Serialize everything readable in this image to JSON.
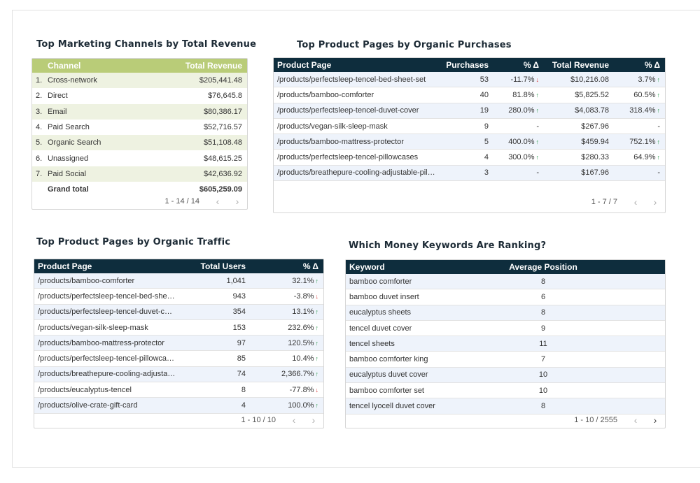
{
  "channels": {
    "title": "Top Marketing Channels by Total Revenue",
    "headers": [
      "Channel",
      "Total Revenue"
    ],
    "rows": [
      {
        "idx": "1.",
        "name": "Cross-network",
        "value": "$205,441.48"
      },
      {
        "idx": "2.",
        "name": "Direct",
        "value": "$76,645.8"
      },
      {
        "idx": "3.",
        "name": "Email",
        "value": "$80,386.17"
      },
      {
        "idx": "4.",
        "name": "Paid Search",
        "value": "$52,716.57"
      },
      {
        "idx": "5.",
        "name": "Organic Search",
        "value": "$51,108.48"
      },
      {
        "idx": "6.",
        "name": "Unassigned",
        "value": "$48,615.25"
      },
      {
        "idx": "7.",
        "name": "Paid Social",
        "value": "$42,636.92"
      }
    ],
    "total_label": "Grand total",
    "total_value": "$605,259.09",
    "pager": "1 - 14 / 14"
  },
  "purchases": {
    "title": "Top Product Pages by Organic Purchases",
    "headers": [
      "Product Page",
      "Purchases",
      "% Δ",
      "Total Revenue",
      "% Δ"
    ],
    "rows": [
      {
        "page": "/products/perfectsleep-tencel-bed-sheet-set",
        "purchases": "53",
        "pd": "-11.7%",
        "pd_dir": "down",
        "rev": "$10,216.08",
        "rd": "3.7%",
        "rd_dir": "up"
      },
      {
        "page": "/products/bamboo-comforter",
        "purchases": "40",
        "pd": "81.8%",
        "pd_dir": "up",
        "rev": "$5,825.52",
        "rd": "60.5%",
        "rd_dir": "up"
      },
      {
        "page": "/products/perfectsleep-tencel-duvet-cover",
        "purchases": "19",
        "pd": "280.0%",
        "pd_dir": "up",
        "rev": "$4,083.78",
        "rd": "318.4%",
        "rd_dir": "up"
      },
      {
        "page": "/products/vegan-silk-sleep-mask",
        "purchases": "9",
        "pd": "-",
        "pd_dir": "",
        "rev": "$267.96",
        "rd": "-",
        "rd_dir": ""
      },
      {
        "page": "/products/bamboo-mattress-protector",
        "purchases": "5",
        "pd": "400.0%",
        "pd_dir": "up",
        "rev": "$459.94",
        "rd": "752.1%",
        "rd_dir": "up"
      },
      {
        "page": "/products/perfectsleep-tencel-pillowcases",
        "purchases": "4",
        "pd": "300.0%",
        "pd_dir": "up",
        "rev": "$280.33",
        "rd": "64.9%",
        "rd_dir": "up"
      },
      {
        "page": "/products/breathepure-cooling-adjustable-pil…",
        "purchases": "3",
        "pd": "-",
        "pd_dir": "",
        "rev": "$167.96",
        "rd": "-",
        "rd_dir": ""
      }
    ],
    "pager": "1 - 7 / 7"
  },
  "traffic": {
    "title": "Top Product Pages by Organic Traffic",
    "headers": [
      "Product Page",
      "Total Users",
      "% Δ"
    ],
    "rows": [
      {
        "page": "/products/bamboo-comforter",
        "users": "1,041",
        "d": "32.1%",
        "dir": "up"
      },
      {
        "page": "/products/perfectsleep-tencel-bed-she…",
        "users": "943",
        "d": "-3.8%",
        "dir": "down"
      },
      {
        "page": "/products/perfectsleep-tencel-duvet-c…",
        "users": "354",
        "d": "13.1%",
        "dir": "up"
      },
      {
        "page": "/products/vegan-silk-sleep-mask",
        "users": "153",
        "d": "232.6%",
        "dir": "up"
      },
      {
        "page": "/products/bamboo-mattress-protector",
        "users": "97",
        "d": "120.5%",
        "dir": "up"
      },
      {
        "page": "/products/perfectsleep-tencel-pillowca…",
        "users": "85",
        "d": "10.4%",
        "dir": "up"
      },
      {
        "page": "/products/breathepure-cooling-adjusta…",
        "users": "74",
        "d": "2,366.7%",
        "dir": "up"
      },
      {
        "page": "/products/eucalyptus-tencel",
        "users": "8",
        "d": "-77.8%",
        "dir": "down"
      },
      {
        "page": "/products/olive-crate-gift-card",
        "users": "4",
        "d": "100.0%",
        "dir": "up"
      }
    ],
    "pager": "1 - 10 / 10"
  },
  "keywords": {
    "title": "Which Money Keywords Are Ranking?",
    "headers": [
      "Keyword",
      "Average Position"
    ],
    "rows": [
      {
        "kw": "bamboo comforter",
        "pos": "8"
      },
      {
        "kw": "bamboo duvet insert",
        "pos": "6"
      },
      {
        "kw": "eucalyptus sheets",
        "pos": "8"
      },
      {
        "kw": "tencel duvet cover",
        "pos": "9"
      },
      {
        "kw": "tencel sheets",
        "pos": "11"
      },
      {
        "kw": "bamboo comforter king",
        "pos": "7"
      },
      {
        "kw": "eucalyptus duvet cover",
        "pos": "10"
      },
      {
        "kw": "bamboo comforter set",
        "pos": "10"
      },
      {
        "kw": "tencel lyocell duvet cover",
        "pos": "8"
      }
    ],
    "pager": "1 - 10 / 2555"
  },
  "icons": {
    "prev": "chevron-left-icon",
    "next": "chevron-right-icon",
    "up": "arrow-up-icon",
    "down": "arrow-down-icon"
  },
  "colors": {
    "dark_header": "#0e2d3d",
    "green_header": "#b9cc78",
    "up": "#2e9b4f",
    "down": "#d93c3c"
  }
}
